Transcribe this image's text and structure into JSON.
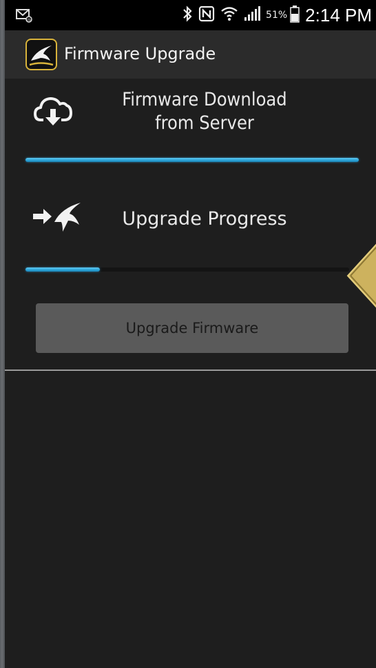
{
  "status_bar": {
    "battery_percent": "51%",
    "time": "2:14 PM",
    "icons": [
      "email-notification-icon",
      "bluetooth-icon",
      "nfc-icon",
      "wifi-icon",
      "signal-icon",
      "battery-icon"
    ]
  },
  "action_bar": {
    "title": "Firmware Upgrade",
    "app_icon": "swift-bird-logo-icon",
    "accent_color": "#d9b43b"
  },
  "download": {
    "label": "Firmware Download\nfrom Server",
    "icon": "cloud-download-icon",
    "progress": 1.0
  },
  "upgrade": {
    "label": "Upgrade Progress",
    "icon": "arrow-bird-icon",
    "progress": 0.23
  },
  "button": {
    "label": "Upgrade Firmware"
  },
  "colors": {
    "progress_fill": "#2aa3d8",
    "background": "#1e1e1e",
    "button": "#5a5a5a",
    "callout": "#cdb25e"
  }
}
